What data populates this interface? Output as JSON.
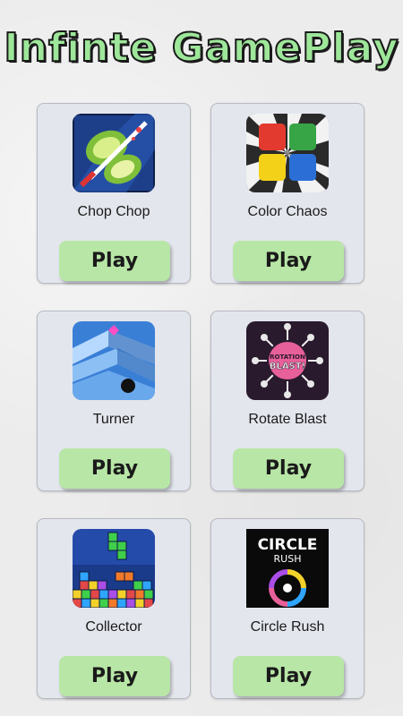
{
  "app": {
    "title": "Infinte GamePlay"
  },
  "games": [
    {
      "name": "Chop Chop",
      "play_label": "Play",
      "icon": "fruit-ninja-icon"
    },
    {
      "name": "Color Chaos",
      "play_label": "Play",
      "icon": "color-chaos-icon"
    },
    {
      "name": "Turner",
      "play_label": "Play",
      "icon": "zigzag-icon"
    },
    {
      "name": "Rotate Blast",
      "play_label": "Play",
      "icon": "rotation-blast-icon",
      "icon_text_top": "ROTATION",
      "icon_text_bottom": "BLAST!"
    },
    {
      "name": "Collector",
      "play_label": "Play",
      "icon": "block-puzzle-icon"
    },
    {
      "name": "Circle Rush",
      "play_label": "Play",
      "icon": "circle-rush-icon",
      "icon_text_top": "CIRCLE",
      "icon_text_bottom": "RUSH"
    }
  ],
  "colors": {
    "title": "#9ee79a",
    "play_button": "#b8e6a6",
    "card": "#e3e6ed"
  }
}
